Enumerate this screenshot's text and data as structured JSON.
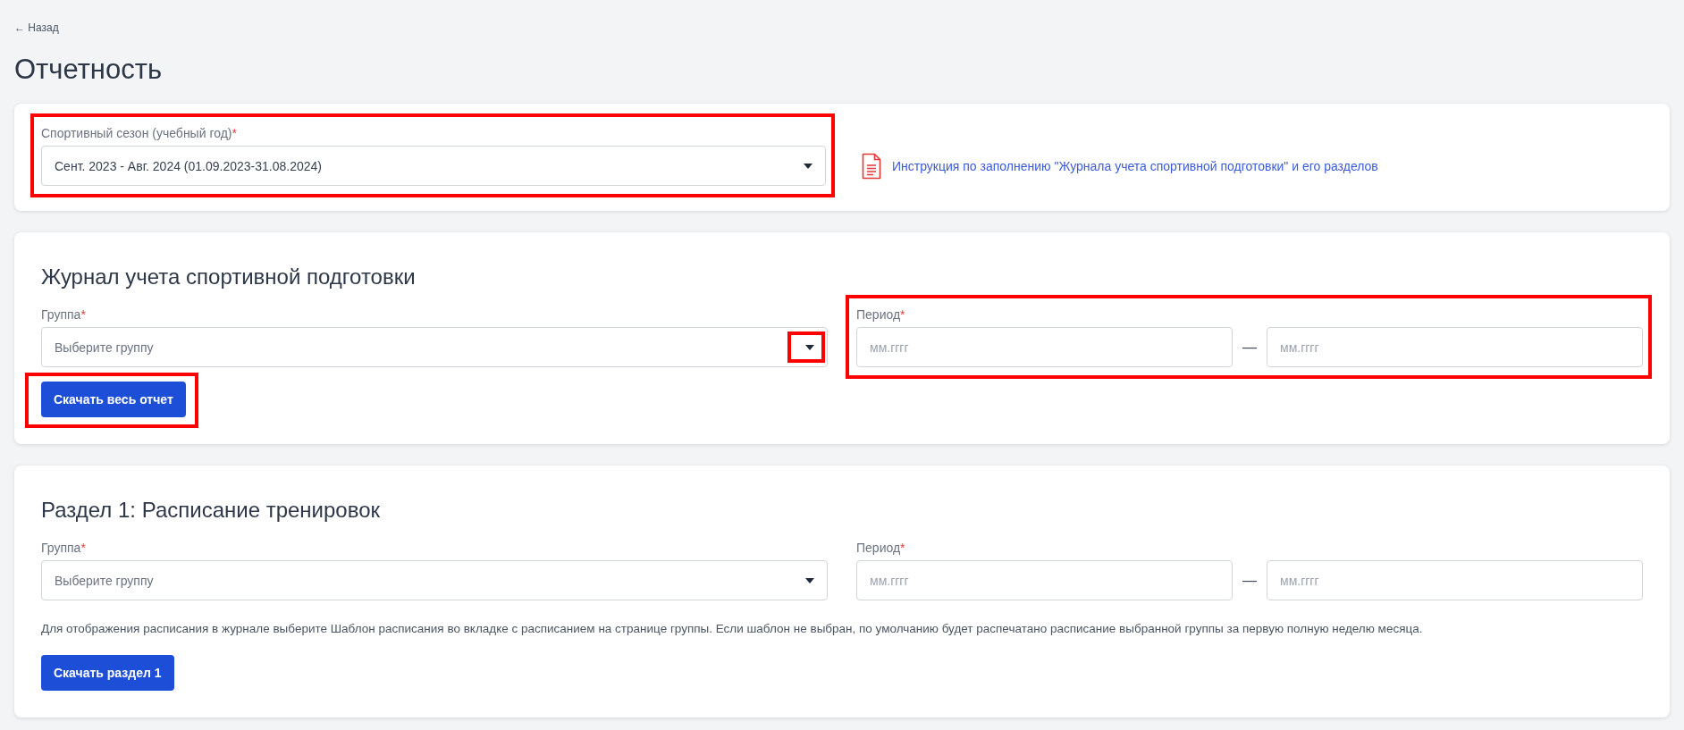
{
  "back_link": "← Назад",
  "page_title": "Отчетность",
  "season": {
    "label": "Спортивный сезон (учебный год)",
    "required_mark": "*",
    "value": "Сент. 2023 - Авг. 2024 (01.09.2023-31.08.2024)",
    "highlighted": true
  },
  "instruction_link": "Инструкция по заполнению \"Журнала учета спортивной подготовки\" и его разделов",
  "sections": [
    {
      "title": "Журнал учета спортивной подготовки",
      "group": {
        "label": "Группа",
        "required_mark": "*",
        "placeholder": "Выберите группу",
        "caret_highlighted": true
      },
      "period": {
        "label": "Период",
        "required_mark": "*",
        "from_placeholder": "мм.гггг",
        "separator": "—",
        "to_placeholder": "мм.гггг",
        "highlighted": true
      },
      "button": {
        "label": "Скачать весь отчет",
        "highlighted": true
      }
    },
    {
      "title": "Раздел 1: Расписание тренировок",
      "group": {
        "label": "Группа",
        "required_mark": "*",
        "placeholder": "Выберите группу",
        "caret_highlighted": false
      },
      "period": {
        "label": "Период",
        "required_mark": "*",
        "from_placeholder": "мм.гггг",
        "separator": "—",
        "to_placeholder": "мм.гггг",
        "highlighted": false
      },
      "note": "Для отображения расписания в журнале выберите Шаблон расписания во вкладке с расписанием на странице группы. Если шаблон не выбран, по умолчанию будет распечатано расписание выбранной группы за первую полную неделю месяца.",
      "button": {
        "label": "Скачать раздел 1",
        "highlighted": false
      }
    }
  ]
}
